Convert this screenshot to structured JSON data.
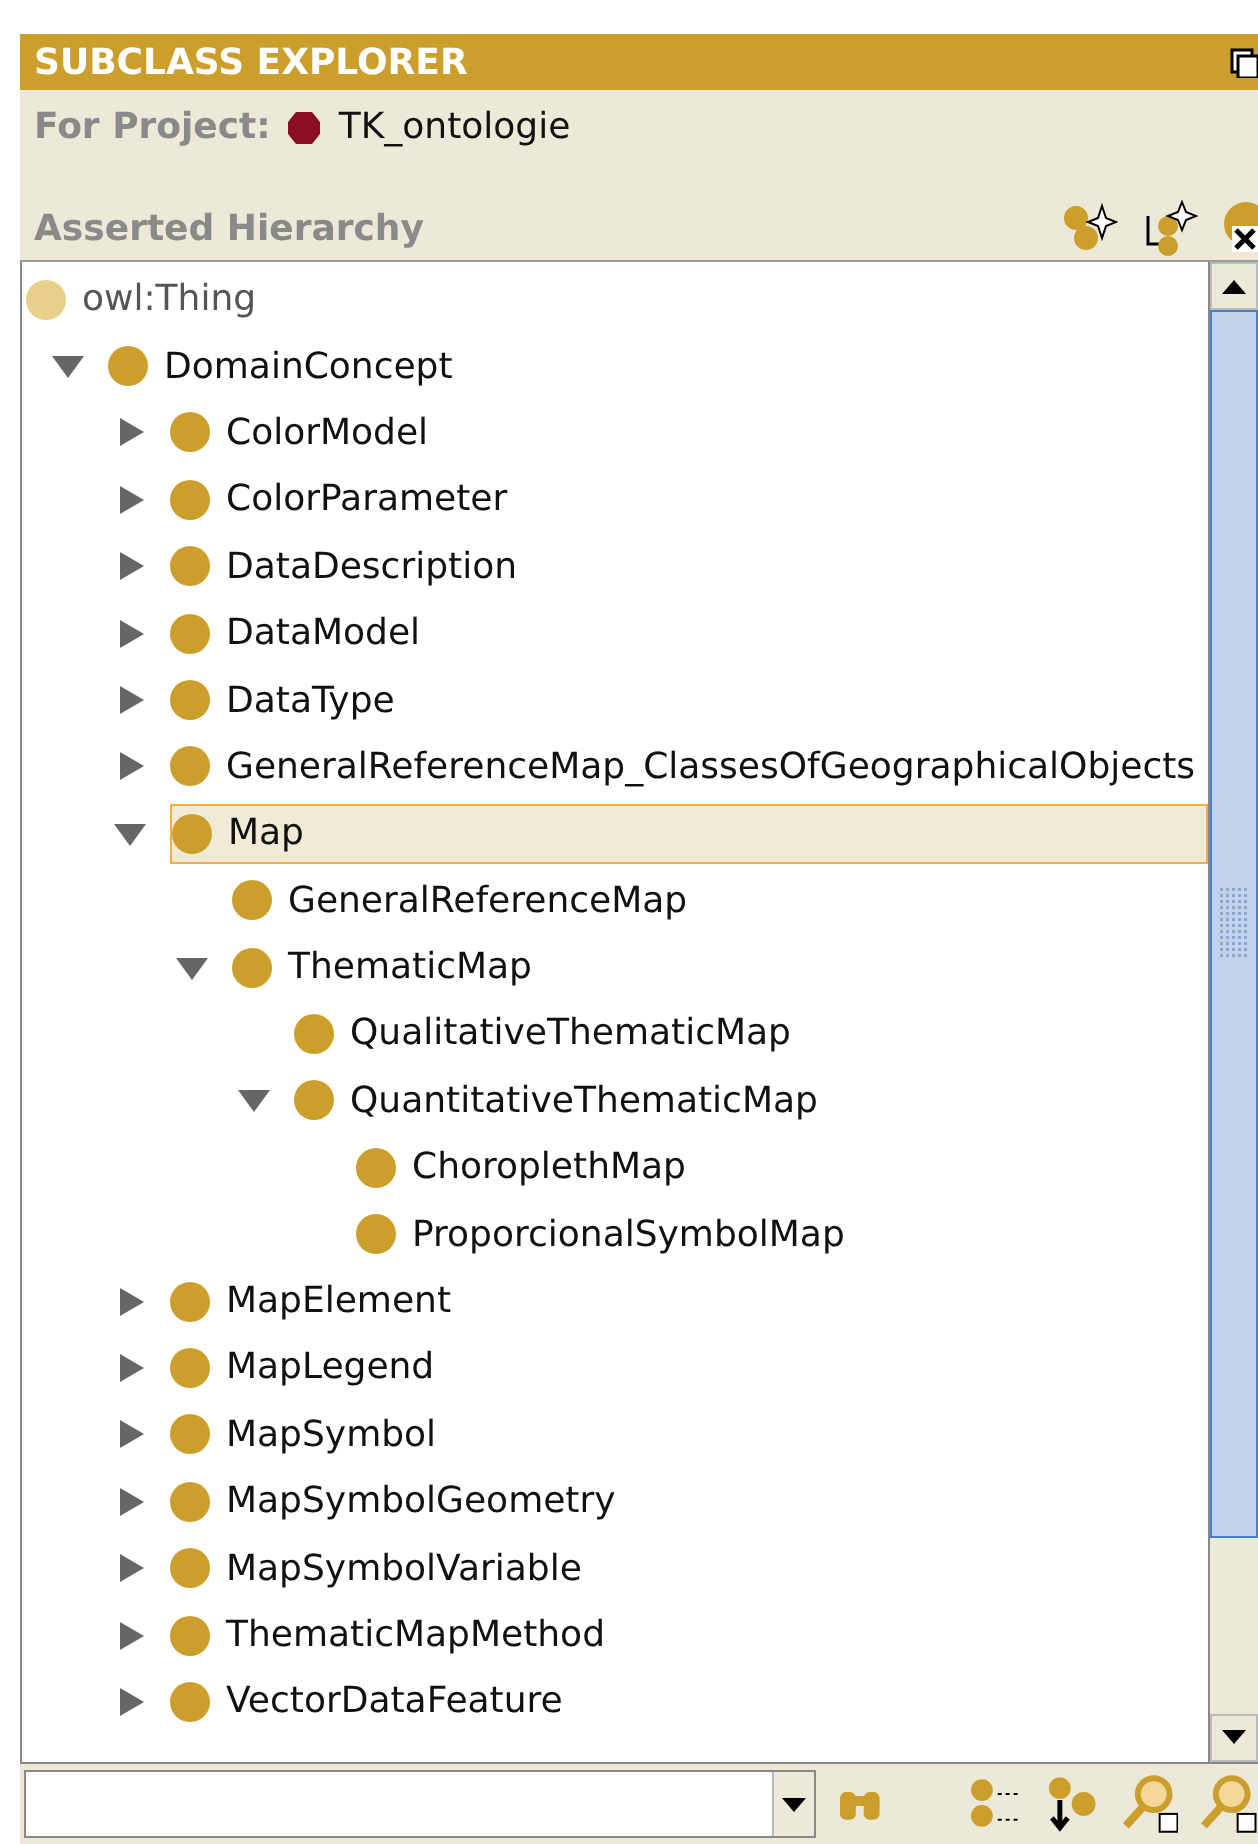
{
  "panel": {
    "title": "SUBCLASS EXPLORER"
  },
  "project": {
    "label": "For Project:",
    "name": "TK_ontologie"
  },
  "hierarchy": {
    "title": "Asserted Hierarchy"
  },
  "root": {
    "label": "owl:Thing",
    "color": "#e8cf8a"
  },
  "tree": [
    {
      "label": "DomainConcept",
      "expanded": true,
      "selected": false,
      "children": [
        {
          "label": "ColorModel",
          "expanded": false,
          "selected": false
        },
        {
          "label": "ColorParameter",
          "expanded": false,
          "selected": false
        },
        {
          "label": "DataDescription",
          "expanded": false,
          "selected": false
        },
        {
          "label": "DataModel",
          "expanded": false,
          "selected": false
        },
        {
          "label": "DataType",
          "expanded": false,
          "selected": false
        },
        {
          "label": "GeneralReferenceMap_ClassesOfGeographicalObjects",
          "expanded": false,
          "selected": false
        },
        {
          "label": "Map",
          "expanded": true,
          "selected": true,
          "children": [
            {
              "label": "GeneralReferenceMap",
              "selected": false
            },
            {
              "label": "ThematicMap",
              "expanded": true,
              "selected": false,
              "children": [
                {
                  "label": "QualitativeThematicMap",
                  "selected": false
                },
                {
                  "label": "QuantitativeThematicMap",
                  "expanded": true,
                  "selected": false,
                  "children": [
                    {
                      "label": "ChoroplethMap",
                      "selected": false
                    },
                    {
                      "label": "ProporcionalSymbolMap",
                      "selected": false
                    }
                  ]
                }
              ]
            }
          ]
        },
        {
          "label": "MapElement",
          "expanded": false,
          "selected": false
        },
        {
          "label": "MapLegend",
          "expanded": false,
          "selected": false
        },
        {
          "label": "MapSymbol",
          "expanded": false,
          "selected": false
        },
        {
          "label": "MapSymbolGeometry",
          "expanded": false,
          "selected": false
        },
        {
          "label": "MapSymbolVariable",
          "expanded": false,
          "selected": false
        },
        {
          "label": "ThematicMapMethod",
          "expanded": false,
          "selected": false
        },
        {
          "label": "VectorDataFeature",
          "expanded": false,
          "selected": false
        }
      ]
    }
  ]
}
